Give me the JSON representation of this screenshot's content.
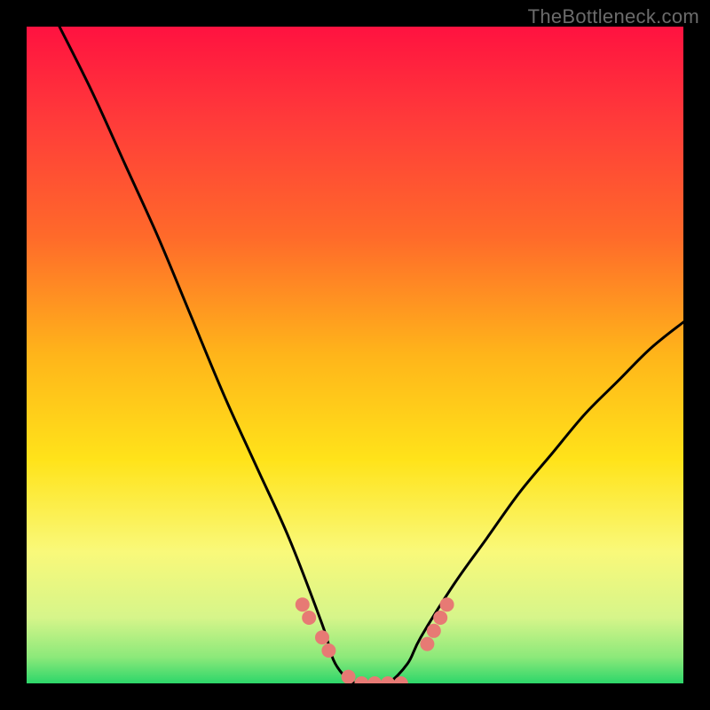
{
  "watermark": "TheBottleneck.com",
  "chart_data": {
    "type": "line",
    "title": "",
    "xlabel": "",
    "ylabel": "",
    "xlim": [
      0,
      100
    ],
    "ylim": [
      0,
      100
    ],
    "grid": false,
    "legend": false,
    "gradient_stops": [
      {
        "pct": 0,
        "color": "#ff1240"
      },
      {
        "pct": 14,
        "color": "#ff3a3a"
      },
      {
        "pct": 32,
        "color": "#ff6a2a"
      },
      {
        "pct": 50,
        "color": "#ffb51a"
      },
      {
        "pct": 66,
        "color": "#ffe31a"
      },
      {
        "pct": 80,
        "color": "#f9f97a"
      },
      {
        "pct": 90,
        "color": "#d6f58a"
      },
      {
        "pct": 96,
        "color": "#8ce97a"
      },
      {
        "pct": 100,
        "color": "#2dd66a"
      }
    ],
    "series": [
      {
        "name": "bottleneck-curve",
        "color": "#000000",
        "x": [
          5,
          10,
          15,
          20,
          25,
          30,
          35,
          40,
          45,
          47,
          50,
          53,
          55,
          58,
          60,
          65,
          70,
          75,
          80,
          85,
          90,
          95,
          100
        ],
        "y": [
          100,
          90,
          79,
          68,
          56,
          44,
          33,
          22,
          9,
          3,
          0,
          0,
          0,
          3,
          7,
          15,
          22,
          29,
          35,
          41,
          46,
          51,
          55
        ]
      }
    ],
    "markers": {
      "name": "highlight-points",
      "color": "#e77a74",
      "radius_px": 8,
      "points": [
        {
          "x": 42,
          "y": 12
        },
        {
          "x": 43,
          "y": 10
        },
        {
          "x": 45,
          "y": 7
        },
        {
          "x": 46,
          "y": 5
        },
        {
          "x": 49,
          "y": 1
        },
        {
          "x": 51,
          "y": 0
        },
        {
          "x": 53,
          "y": 0
        },
        {
          "x": 55,
          "y": 0
        },
        {
          "x": 57,
          "y": 0
        },
        {
          "x": 61,
          "y": 6
        },
        {
          "x": 62,
          "y": 8
        },
        {
          "x": 63,
          "y": 10
        },
        {
          "x": 64,
          "y": 12
        }
      ]
    }
  }
}
